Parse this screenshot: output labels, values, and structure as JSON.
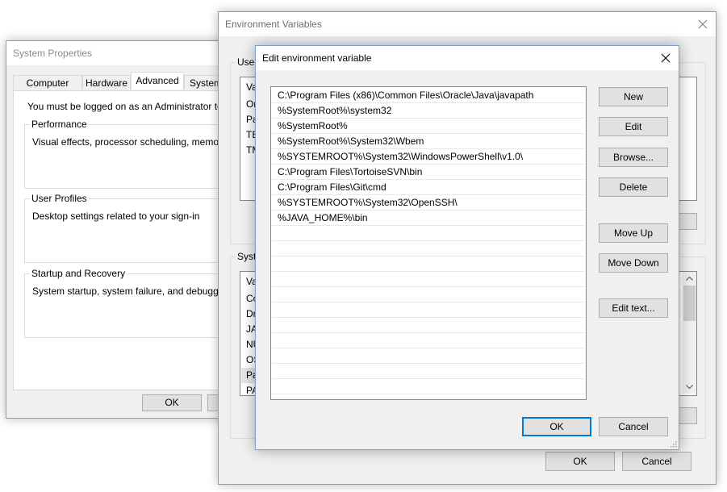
{
  "system_properties": {
    "title": "System Properties",
    "tabs": [
      "Computer Name",
      "Hardware",
      "Advanced",
      "System F"
    ],
    "active_tab": "Advanced",
    "admin_note": "You must be logged on as an Administrator to make",
    "performance": {
      "legend": "Performance",
      "text": "Visual effects, processor scheduling, memory usac"
    },
    "user_profiles": {
      "legend": "User Profiles",
      "text": "Desktop settings related to your sign-in"
    },
    "startup": {
      "legend": "Startup and Recovery",
      "text": "System startup, system failure, and debugging info"
    },
    "ok_label": "OK"
  },
  "env_vars": {
    "title": "Environment Variables",
    "user_section_label": "User",
    "user_col_header": "Va",
    "user_rows": [
      "On",
      "Pa",
      "TE",
      "TM"
    ],
    "system_section_label": "Syste",
    "system_col_header": "Va",
    "system_rows": [
      "Co",
      "Dr",
      "JA",
      "NU",
      "OS",
      "Pa",
      "PA"
    ],
    "ok_label": "OK",
    "cancel_label": "Cancel"
  },
  "edit_dialog": {
    "title": "Edit environment variable",
    "paths": [
      "C:\\Program Files (x86)\\Common Files\\Oracle\\Java\\javapath",
      "%SystemRoot%\\system32",
      "%SystemRoot%",
      "%SystemRoot%\\System32\\Wbem",
      "%SYSTEMROOT%\\System32\\WindowsPowerShell\\v1.0\\",
      "C:\\Program Files\\TortoiseSVN\\bin",
      "C:\\Program Files\\Git\\cmd",
      "%SYSTEMROOT%\\System32\\OpenSSH\\",
      "%JAVA_HOME%\\bin"
    ],
    "buttons": {
      "new": "New",
      "edit": "Edit",
      "browse": "Browse...",
      "delete": "Delete",
      "move_up": "Move Up",
      "move_down": "Move Down",
      "edit_text": "Edit text...",
      "ok": "OK",
      "cancel": "Cancel"
    }
  }
}
